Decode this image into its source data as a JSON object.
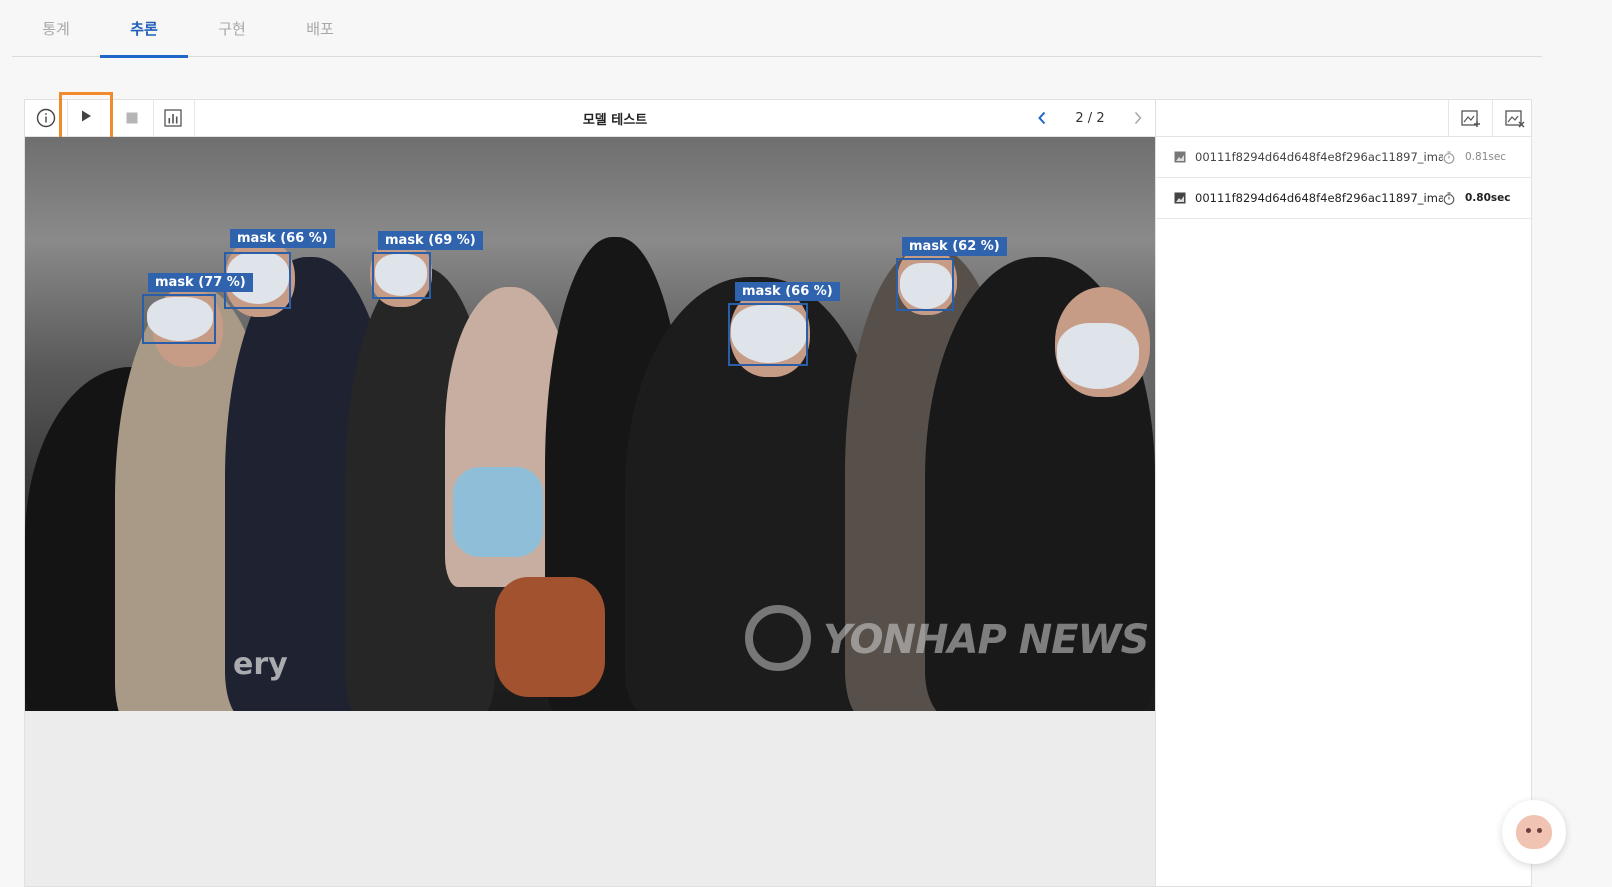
{
  "tabs": [
    {
      "label": "통계",
      "active": false
    },
    {
      "label": "추론",
      "active": true
    },
    {
      "label": "구현",
      "active": false
    },
    {
      "label": "배포",
      "active": false
    }
  ],
  "toolbar": {
    "title": "모델 테스트",
    "pager": "2 / 2",
    "icons": [
      "info-icon",
      "play-icon",
      "stop-icon",
      "chart-icon",
      "chevron-left-icon",
      "chevron-right-icon"
    ],
    "highlight_color": "#f08a2c"
  },
  "detections": [
    {
      "label": "mask (66 %)"
    },
    {
      "label": "mask (69 %)"
    },
    {
      "label": "mask (77 %)"
    },
    {
      "label": "mask (66 %)"
    },
    {
      "label": "mask (62 %)"
    }
  ],
  "watermark": {
    "brand": "YONHAP NEWS",
    "left_text": "ery"
  },
  "results": [
    {
      "file": "00111f8294d64d648f4e8f296ac11897_imag...",
      "time": "0.81sec",
      "active": false
    },
    {
      "file": "00111f8294d64d648f4e8f296ac11897_imag...",
      "time": "0.80sec",
      "active": true
    }
  ],
  "side_toolbar": {
    "icons": [
      "add-image-icon",
      "remove-image-icon"
    ]
  },
  "colors": {
    "accent": "#1f66c8",
    "detection": "#2f63ad"
  }
}
